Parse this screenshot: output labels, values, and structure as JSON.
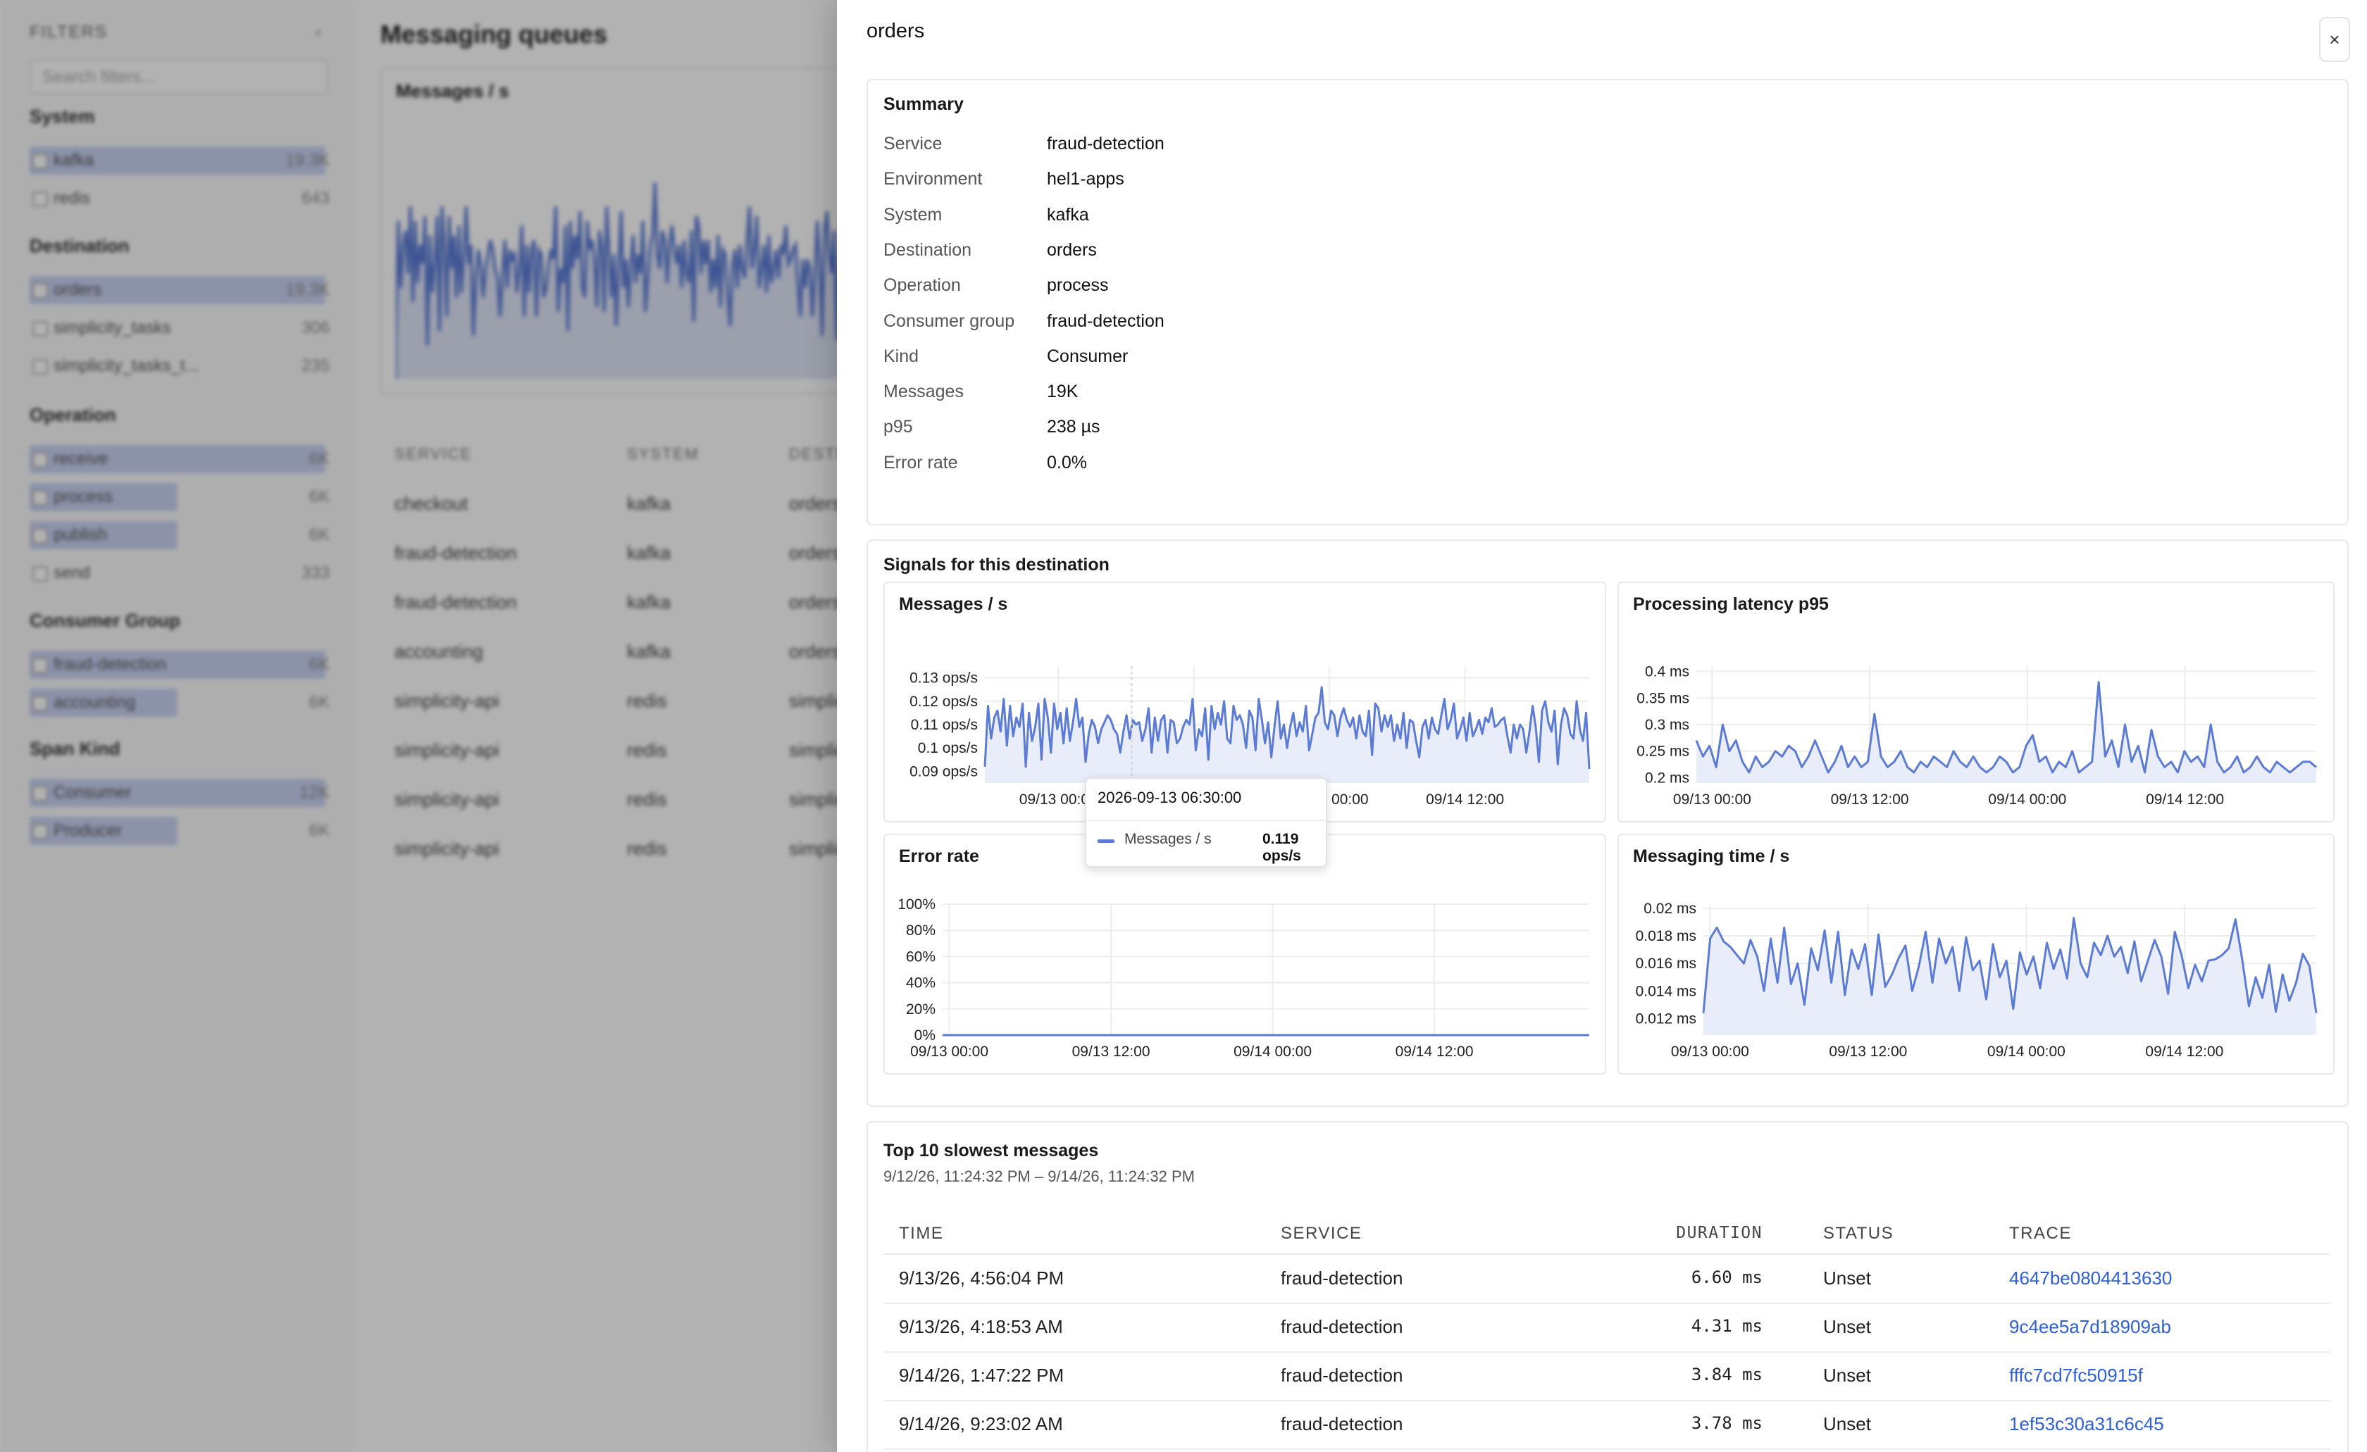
{
  "background": {
    "filters_title": "FILTERS",
    "search_placeholder": "Search filters...",
    "groups": [
      {
        "title": "System",
        "items": [
          {
            "label": "kafka",
            "count": "19.3K",
            "fill": 1.0
          },
          {
            "label": "redis",
            "count": "643",
            "fill": 0
          }
        ]
      },
      {
        "title": "Destination",
        "items": [
          {
            "label": "orders",
            "count": "19.3K",
            "fill": 1.0
          },
          {
            "label": "simplicity_tasks",
            "count": "306",
            "fill": 0
          },
          {
            "label": "simplicity_tasks_t...",
            "count": "235",
            "fill": 0
          }
        ]
      },
      {
        "title": "Operation",
        "items": [
          {
            "label": "receive",
            "count": "6K",
            "fill": 1.0
          },
          {
            "label": "process",
            "count": "6K",
            "fill": 0.5
          },
          {
            "label": "publish",
            "count": "6K",
            "fill": 0.5
          },
          {
            "label": "send",
            "count": "333",
            "fill": 0
          }
        ]
      },
      {
        "title": "Consumer Group",
        "items": [
          {
            "label": "fraud-detection",
            "count": "6K",
            "fill": 1.0
          },
          {
            "label": "accounting",
            "count": "6K",
            "fill": 0.5
          }
        ]
      },
      {
        "title": "Span Kind",
        "items": [
          {
            "label": "Consumer",
            "count": "12K",
            "fill": 1.0
          },
          {
            "label": "Producer",
            "count": "6K",
            "fill": 0.5
          }
        ]
      }
    ],
    "main_title": "Messaging queues",
    "chart_title": "Messages / s",
    "table_headers": [
      "SERVICE",
      "SYSTEM",
      "DESTINATION"
    ],
    "table_rows": [
      [
        "checkout",
        "kafka",
        "orders"
      ],
      [
        "fraud-detection",
        "kafka",
        "orders"
      ],
      [
        "fraud-detection",
        "kafka",
        "orders"
      ],
      [
        "accounting",
        "kafka",
        "orders"
      ],
      [
        "simplicity-api",
        "redis",
        "simplicity_tasks"
      ],
      [
        "simplicity-api",
        "redis",
        "simplicity_tasks"
      ],
      [
        "simplicity-api",
        "redis",
        "simplicity_tasks"
      ],
      [
        "simplicity-api",
        "redis",
        "simplicity_tasks"
      ]
    ]
  },
  "drawer": {
    "title": "orders",
    "close_label": "×",
    "summary": {
      "title": "Summary",
      "rows": [
        {
          "key": "Service",
          "value": "fraud-detection"
        },
        {
          "key": "Environment",
          "value": "hel1-apps"
        },
        {
          "key": "System",
          "value": "kafka"
        },
        {
          "key": "Destination",
          "value": "orders"
        },
        {
          "key": "Operation",
          "value": "process"
        },
        {
          "key": "Consumer group",
          "value": "fraud-detection"
        },
        {
          "key": "Kind",
          "value": "Consumer"
        },
        {
          "key": "Messages",
          "value": "19K"
        },
        {
          "key": "p95",
          "value": "238 µs"
        },
        {
          "key": "Error rate",
          "value": "0.0%"
        }
      ]
    },
    "signals_title": "Signals for this destination",
    "tooltip": {
      "time": "2026-09-13 06:30:00",
      "series": "Messages / s",
      "value": "0.119 ops/s"
    },
    "slowest": {
      "title": "Top 10 slowest messages",
      "range": "9/12/26, 11:24:32 PM – 9/14/26, 11:24:32 PM",
      "headers": {
        "time": "TIME",
        "service": "SERVICE",
        "duration": "DURATION",
        "status": "STATUS",
        "trace": "TRACE"
      },
      "rows": [
        {
          "time": "9/13/26, 4:56:04 PM",
          "service": "fraud-detection",
          "duration": "6.60 ms",
          "status": "Unset",
          "trace": "4647be0804413630"
        },
        {
          "time": "9/13/26, 4:18:53 AM",
          "service": "fraud-detection",
          "duration": "4.31 ms",
          "status": "Unset",
          "trace": "9c4ee5a7d18909ab"
        },
        {
          "time": "9/14/26, 1:47:22 PM",
          "service": "fraud-detection",
          "duration": "3.84 ms",
          "status": "Unset",
          "trace": "fffc7cd7fc50915f"
        },
        {
          "time": "9/14/26, 9:23:02 AM",
          "service": "fraud-detection",
          "duration": "3.78 ms",
          "status": "Unset",
          "trace": "1ef53c30a31c6c45"
        }
      ]
    }
  },
  "colors": {
    "series": "#5b7bd5",
    "series_fill": "#e9edf9",
    "link": "#2f5fd6"
  },
  "chart_data": [
    {
      "type": "line",
      "title": "Messages / s",
      "y_ticks": [
        "0.13 ops/s",
        "0.12 ops/s",
        "0.11 ops/s",
        "0.1 ops/s",
        "0.09 ops/s"
      ],
      "y_tick_values": [
        0.13,
        0.12,
        0.11,
        0.1,
        0.09
      ],
      "x_ticks": [
        "09/13 00:00",
        "09/13 12:00",
        "09/14 00:00",
        "09/14 12:00"
      ],
      "x_tick_hours": [
        0,
        12,
        24,
        36
      ],
      "x_range_hours": [
        -6.5,
        47
      ],
      "ylim": [
        0.085,
        0.135
      ],
      "series": [
        {
          "values": [
            0.092,
            0.118,
            0.104,
            0.113,
            0.116,
            0.107,
            0.121,
            0.101,
            0.118,
            0.105,
            0.113,
            0.109,
            0.119,
            0.092,
            0.115,
            0.103,
            0.109,
            0.119,
            0.095,
            0.121,
            0.113,
            0.098,
            0.119,
            0.108,
            0.115,
            0.102,
            0.117,
            0.103,
            0.111,
            0.121,
            0.109,
            0.113,
            0.094,
            0.106,
            0.112,
            0.109,
            0.102,
            0.108,
            0.111,
            0.114,
            0.112,
            0.108,
            0.106,
            0.098,
            0.107,
            0.114,
            0.104,
            0.112,
            0.11,
            0.111,
            0.103,
            0.108,
            0.117,
            0.098,
            0.113,
            0.103,
            0.112,
            0.114,
            0.098,
            0.112,
            0.111,
            0.102,
            0.104,
            0.109,
            0.112,
            0.11,
            0.121,
            0.099,
            0.108,
            0.105,
            0.117,
            0.095,
            0.118,
            0.108,
            0.115,
            0.11,
            0.12,
            0.104,
            0.102,
            0.118,
            0.112,
            0.114,
            0.11,
            0.1,
            0.116,
            0.113,
            0.099,
            0.121,
            0.112,
            0.102,
            0.111,
            0.096,
            0.109,
            0.12,
            0.104,
            0.11,
            0.1,
            0.109,
            0.115,
            0.105,
            0.111,
            0.107,
            0.118,
            0.099,
            0.106,
            0.113,
            0.115,
            0.126,
            0.111,
            0.108,
            0.116,
            0.114,
            0.105,
            0.113,
            0.117,
            0.112,
            0.109,
            0.113,
            0.104,
            0.114,
            0.107,
            0.105,
            0.116,
            0.097,
            0.119,
            0.117,
            0.107,
            0.114,
            0.109,
            0.114,
            0.103,
            0.11,
            0.104,
            0.115,
            0.1,
            0.112,
            0.111,
            0.103,
            0.096,
            0.109,
            0.112,
            0.104,
            0.113,
            0.108,
            0.106,
            0.114,
            0.121,
            0.108,
            0.112,
            0.119,
            0.104,
            0.108,
            0.113,
            0.103,
            0.115,
            0.105,
            0.108,
            0.112,
            0.106,
            0.113,
            0.111,
            0.117,
            0.109,
            0.11,
            0.112,
            0.113,
            0.105,
            0.098,
            0.11,
            0.104,
            0.11,
            0.108,
            0.098,
            0.107,
            0.118,
            0.109,
            0.094,
            0.116,
            0.12,
            0.111,
            0.107,
            0.116,
            0.093,
            0.11,
            0.117,
            0.114,
            0.106,
            0.104,
            0.12,
            0.108,
            0.103,
            0.115,
            0.091
          ]
        }
      ]
    },
    {
      "type": "line",
      "title": "Processing latency p95",
      "y_ticks": [
        "0.4 ms",
        "0.35 ms",
        "0.3 ms",
        "0.25 ms",
        "0.2 ms"
      ],
      "y_tick_values": [
        0.4,
        0.35,
        0.3,
        0.25,
        0.2
      ],
      "x_ticks": [
        "09/13 00:00",
        "09/13 12:00",
        "09/14 00:00",
        "09/14 12:00"
      ],
      "x_tick_hours": [
        0,
        12,
        24,
        36
      ],
      "x_range_hours": [
        -1.2,
        46
      ],
      "ylim": [
        0.19,
        0.41
      ],
      "series": [
        {
          "values": [
            0.27,
            0.24,
            0.26,
            0.22,
            0.3,
            0.25,
            0.27,
            0.23,
            0.21,
            0.24,
            0.22,
            0.23,
            0.25,
            0.24,
            0.26,
            0.25,
            0.22,
            0.24,
            0.27,
            0.24,
            0.21,
            0.23,
            0.26,
            0.22,
            0.24,
            0.22,
            0.23,
            0.32,
            0.24,
            0.22,
            0.23,
            0.25,
            0.22,
            0.21,
            0.23,
            0.22,
            0.24,
            0.23,
            0.22,
            0.25,
            0.23,
            0.22,
            0.24,
            0.22,
            0.21,
            0.22,
            0.24,
            0.23,
            0.21,
            0.22,
            0.26,
            0.28,
            0.23,
            0.24,
            0.21,
            0.23,
            0.22,
            0.25,
            0.21,
            0.22,
            0.23,
            0.38,
            0.24,
            0.27,
            0.22,
            0.3,
            0.23,
            0.26,
            0.21,
            0.29,
            0.24,
            0.22,
            0.23,
            0.21,
            0.25,
            0.23,
            0.24,
            0.22,
            0.3,
            0.23,
            0.21,
            0.22,
            0.24,
            0.21,
            0.22,
            0.24,
            0.22,
            0.21,
            0.23,
            0.22,
            0.21,
            0.22,
            0.23,
            0.23,
            0.22
          ]
        }
      ]
    },
    {
      "type": "line",
      "title": "Error rate",
      "y_ticks": [
        "100%",
        "80%",
        "60%",
        "40%",
        "20%",
        "0%"
      ],
      "y_tick_values": [
        100,
        80,
        60,
        40,
        20,
        0
      ],
      "x_ticks": [
        "09/13 00:00",
        "09/13 12:00",
        "09/14 00:00",
        "09/14 12:00"
      ],
      "x_tick_hours": [
        0,
        12,
        24,
        36
      ],
      "x_range_hours": [
        -0.5,
        47.5
      ],
      "ylim": [
        0,
        100
      ],
      "series": [
        {
          "values": [
            0,
            0
          ]
        }
      ]
    },
    {
      "type": "line",
      "title": "Messaging time / s",
      "y_ticks": [
        "0.02 ms",
        "0.018 ms",
        "0.016 ms",
        "0.014 ms",
        "0.012 ms"
      ],
      "y_tick_values": [
        0.02,
        0.018,
        0.016,
        0.014,
        0.012
      ],
      "x_ticks": [
        "09/13 00:00",
        "09/13 12:00",
        "09/14 00:00",
        "09/14 12:00"
      ],
      "x_tick_hours": [
        0,
        12,
        24,
        36
      ],
      "x_range_hours": [
        -0.5,
        46
      ],
      "ylim": [
        0.0108,
        0.0203
      ],
      "series": [
        {
          "values": [
            0.0124,
            0.0178,
            0.0186,
            0.0176,
            0.0172,
            0.0166,
            0.016,
            0.0177,
            0.0165,
            0.014,
            0.0178,
            0.0146,
            0.0186,
            0.0145,
            0.016,
            0.013,
            0.0171,
            0.0155,
            0.0184,
            0.0146,
            0.0183,
            0.0137,
            0.017,
            0.0156,
            0.0174,
            0.0137,
            0.0181,
            0.0143,
            0.0152,
            0.0164,
            0.0173,
            0.014,
            0.0158,
            0.0183,
            0.0146,
            0.0178,
            0.016,
            0.0172,
            0.014,
            0.0179,
            0.0155,
            0.0162,
            0.0134,
            0.0174,
            0.015,
            0.0162,
            0.0127,
            0.0168,
            0.0152,
            0.0165,
            0.0142,
            0.0175,
            0.0156,
            0.017,
            0.0149,
            0.0193,
            0.016,
            0.015,
            0.0175,
            0.0166,
            0.018,
            0.0165,
            0.0172,
            0.0153,
            0.0176,
            0.0147,
            0.0162,
            0.0177,
            0.0165,
            0.0138,
            0.0183,
            0.0166,
            0.0142,
            0.0159,
            0.0147,
            0.0162,
            0.0163,
            0.0166,
            0.0171,
            0.0192,
            0.0163,
            0.0129,
            0.015,
            0.0135,
            0.0159,
            0.0125,
            0.0152,
            0.0133,
            0.0146,
            0.0167,
            0.0158,
            0.0124
          ]
        }
      ]
    }
  ]
}
